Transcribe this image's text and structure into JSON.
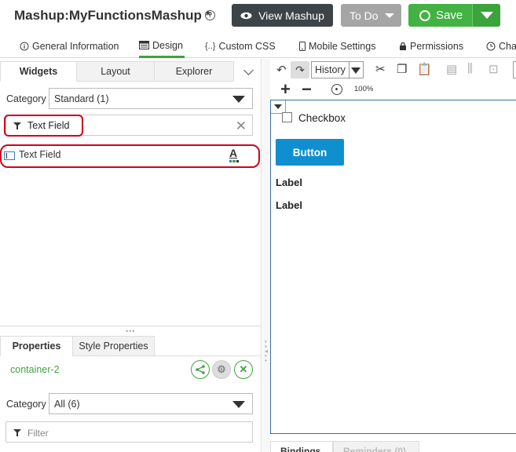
{
  "header": {
    "title": "Mashup:MyFunctionsMashup *",
    "help_icon": "?",
    "view_label": "View Mashup",
    "todo_label": "To Do",
    "save_label": "Save",
    "colors": {
      "save": "#42b242",
      "view": "#3d4347",
      "todo": "#a5a5a5"
    }
  },
  "tabs": [
    {
      "label": "General Information",
      "icon": "info-icon"
    },
    {
      "label": "Design",
      "icon": "design-icon",
      "active": true
    },
    {
      "label": "Custom CSS",
      "icon": "css-icon",
      "glyph": "{..}"
    },
    {
      "label": "Mobile Settings",
      "icon": "mobile-icon"
    },
    {
      "label": "Permissions",
      "icon": "lock-icon"
    },
    {
      "label": "Cha",
      "icon": "clock-icon"
    }
  ],
  "left_panel": {
    "tabs": [
      "Widgets",
      "Layout",
      "Explorer"
    ],
    "category_label": "Category",
    "category_value": "Standard (1)",
    "filter_value": "Text Field",
    "widgets": [
      {
        "name": "Text Field",
        "icon": "text-field-icon",
        "type_icon": "A"
      }
    ]
  },
  "properties": {
    "tabs": [
      "Properties",
      "Style Properties"
    ],
    "container": "container-2",
    "category_label": "Category",
    "category_value": "All (6)",
    "filter_placeholder": "Filter"
  },
  "toolbar": {
    "history_label": "History",
    "zoom": "100%"
  },
  "canvas": {
    "checkbox_label": "Checkbox",
    "button_label": "Button",
    "label_1": "Label",
    "label_2": "Label",
    "button_color": "#0f8fcf"
  },
  "bottom_tabs": [
    "Bindings",
    "Reminders (0)"
  ]
}
